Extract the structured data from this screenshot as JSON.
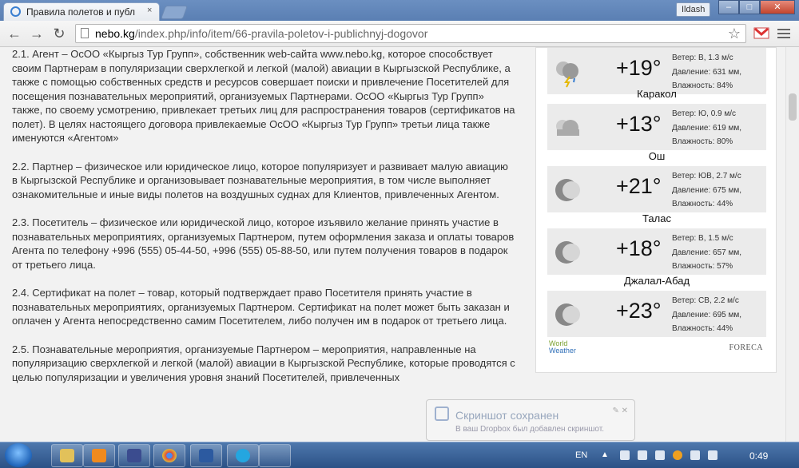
{
  "browser": {
    "tab_title": "Правила полетов и публ",
    "tab_close": "×",
    "user_name": "Ildash",
    "url_host": "nebo.kg",
    "url_path": "/index.php/info/item/66-pravila-poletov-i-publichnyj-dogovor",
    "window_buttons": {
      "minimize": "–",
      "maximize": "□",
      "close": "✕"
    },
    "nav": {
      "back": "←",
      "forward": "→",
      "reload": "↻"
    },
    "star": "☆"
  },
  "article": {
    "paragraphs": [
      "2.1. Агент – ОсОО «Кыргыз Тур Групп», собственник web-сайта www.nebo.kg, которое способствует своим Партнерам в популяризации сверхлегкой и легкой (малой) авиации в Кыргызской Республике, а также с помощью собственных средств и ресурсов совершает поиски и привлечение Посетителей для посещения познавательных мероприятий, организуемых Партнерами. ОсОО «Кыргыз Тур Групп» также, по своему усмотрению, привлекает третьих лиц для распространения товаров (сертификатов на полет). В целях настоящего договора привлекаемые ОсОО «Кыргыз Тур Групп» третьи лица также именуются «Агентом»",
      "2.2. Партнер – физическое или юридическое лицо, которое популяризует и развивает малую авиацию в Кыргызской Республике и организовывает познавательные мероприятия, в том числе выполняет ознакомительные и иные виды полетов на воздушных суднах для Клиентов, привлеченных Агентом.",
      "2.3. Посетитель – физическое или юридической лицо, которое изъявило желание принять участие в познавательных мероприятиях, организуемых Партнером, путем оформления заказа и оплаты товаров Агента по телефону +996 (555) 05-44-50, +996 (555) 05-88-50, или путем получения товаров в подарок от третьего лица.",
      "2.4. Сертификат на полет – товар, который подтверждает право Посетителя принять участие в познавательных мероприятиях, организуемых Партнером. Сертификат на полет может быть заказан и оплачен у Агента непосредственно самим Посетителем, либо получен им в подарок от третьего лица.",
      "2.5. Познавательные мероприятия, организуемые Партнером – мероприятия, направленные на популяризацию сверхлегкой и легкой (малой) авиации в Кыргызской Республике, которые проводятся с целью популяризации и увеличения уровня знаний Посетителей, привлеченных"
    ]
  },
  "weather": {
    "rows": [
      {
        "city": "",
        "icon": "thunderstorm-icon",
        "temp": "+19°",
        "wind": "Ветер: В, 1.3 м/с",
        "pressure": "Давление: 631 мм,",
        "humidity": "Влажность: 84%"
      },
      {
        "city": "Каракол",
        "icon": "cloudy-icon",
        "temp": "+13°",
        "wind": "Ветер: Ю, 0.9 м/с",
        "pressure": "Давление: 619 мм,",
        "humidity": "Влажность: 80%"
      },
      {
        "city": "Ош",
        "icon": "moon-icon",
        "temp": "+21°",
        "wind": "Ветер: ЮВ, 2.7 м/с",
        "pressure": "Давление: 675 мм,",
        "humidity": "Влажность: 44%"
      },
      {
        "city": "Талас",
        "icon": "moon-icon",
        "temp": "+18°",
        "wind": "Ветер: В, 1.5 м/с",
        "pressure": "Давление: 657 мм,",
        "humidity": "Влажность: 57%"
      },
      {
        "city": "Джалал-Абад",
        "icon": "moon-icon",
        "temp": "+23°",
        "wind": "Ветер: СВ, 2.2 м/с",
        "pressure": "Давление: 695 мм,",
        "humidity": "Влажность: 44%"
      }
    ],
    "brand_left_1": "World",
    "brand_left_2": "Weather",
    "brand_right": "FORECA"
  },
  "toast": {
    "title": "Скриншот сохранен",
    "body": "В ваш Dropbox был добавлен скриншот."
  },
  "taskbar": {
    "lang": "EN",
    "clock": "0:49"
  }
}
